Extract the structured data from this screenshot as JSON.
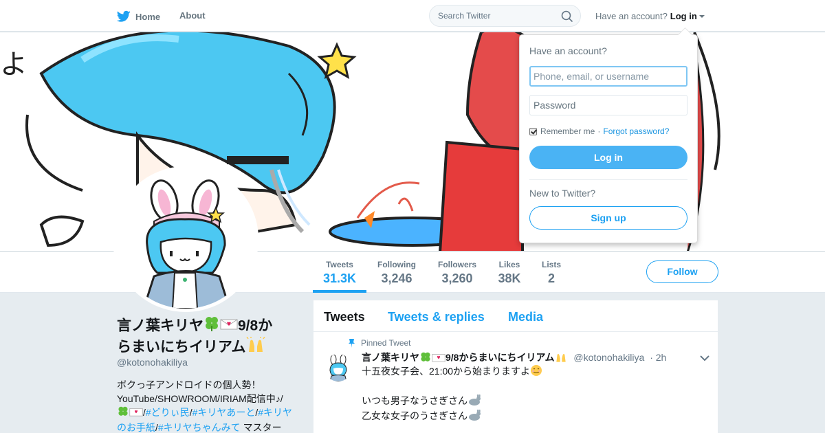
{
  "nav": {
    "home_label": "Home",
    "about_label": "About",
    "search_placeholder": "Search Twitter",
    "account_prompt": "Have an account?",
    "login_label": "Log in"
  },
  "stats": [
    {
      "label": "Tweets",
      "value": "31.3K"
    },
    {
      "label": "Following",
      "value": "3,246"
    },
    {
      "label": "Followers",
      "value": "3,260"
    },
    {
      "label": "Likes",
      "value": "38K"
    },
    {
      "label": "Lists",
      "value": "2"
    }
  ],
  "follow_label": "Follow",
  "profile": {
    "name_part1": "言ノ葉キリヤ",
    "name_part2": "9/8か",
    "name_part3": "らまいにちイリアム",
    "handle": "@kotonohakiliya",
    "bio_line1": "ボクっ子アンドロイドの個人勢！",
    "bio_line2": "YouTube/SHOWROOM/IRIAM配信中♪/",
    "tag1": "#どりぃ民",
    "tag2": "#キリヤあーと",
    "tag3a": "#キリヤ",
    "tag3b": "のお手紙",
    "tag4": "#キリヤちゃんみて",
    "bio_tail": " マスター",
    "sep": "/"
  },
  "timeline": {
    "tabs": [
      "Tweets",
      "Tweets & replies",
      "Media"
    ],
    "pinned_label": "Pinned Tweet",
    "tweet": {
      "name_part1": "言ノ葉キリヤ",
      "name_part2": "9/8からまいにちイリアム",
      "handle": "@kotonohakiliya",
      "time": "· 2h",
      "line1": "十五夜女子会、21:00から始まりますよ",
      "line2": "いつも男子なうさぎさん",
      "line3": "乙女な女子のうさぎさん"
    }
  },
  "login_dropdown": {
    "title": "Have an account?",
    "username_placeholder": "Phone, email, or username",
    "password_placeholder": "Password",
    "remember_label": "Remember me",
    "dot": "·",
    "forgot_label": "Forgot password?",
    "login_button": "Log in",
    "new_label": "New to Twitter?",
    "signup_button": "Sign up"
  },
  "colors": {
    "accent": "#1da1f2",
    "login_button": "#4ab3f4",
    "background": "#e6ecf0"
  }
}
